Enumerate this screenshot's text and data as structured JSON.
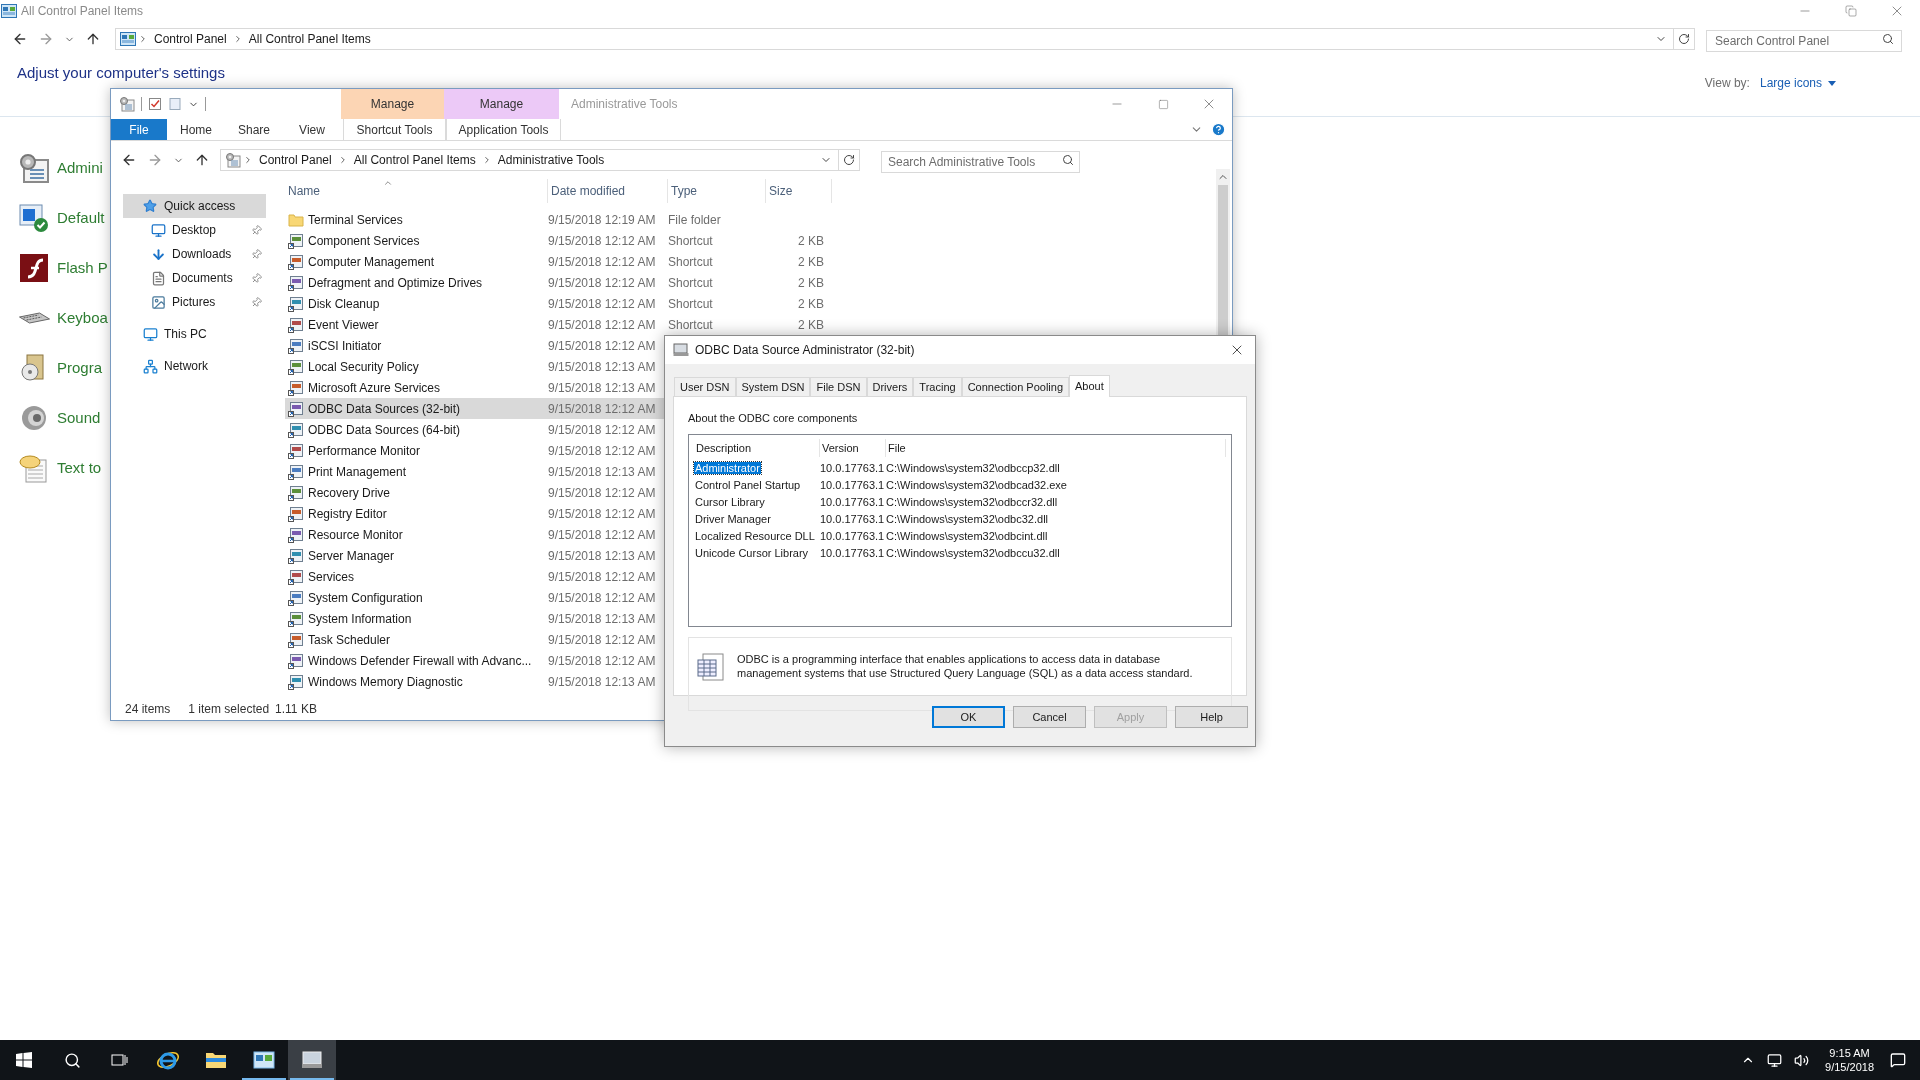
{
  "control_panel": {
    "title": "All Control Panel Items",
    "breadcrumb": [
      "Control Panel",
      "All Control Panel Items"
    ],
    "search": {
      "placeholder": "Search Control Panel"
    },
    "heading": "Adjust your computer's settings",
    "view_by": {
      "label": "View by:",
      "value": "Large icons"
    },
    "items": [
      {
        "label": "Admini"
      },
      {
        "label": "Default"
      },
      {
        "label": "Flash P"
      },
      {
        "label": "Keyboa"
      },
      {
        "label": "Progra"
      },
      {
        "label": "Sound"
      },
      {
        "label": "Text to"
      }
    ]
  },
  "explorer": {
    "title": "Administrative Tools",
    "context_tabs": [
      {
        "group": "Manage",
        "tab": "Shortcut Tools",
        "color": "#fcd5b4"
      },
      {
        "group": "Manage",
        "tab": "Application Tools",
        "color": "#ecc9f7"
      }
    ],
    "ribbon_tabs": [
      {
        "label": "File",
        "kind": "file"
      },
      {
        "label": "Home",
        "kind": "tab"
      },
      {
        "label": "Share",
        "kind": "tab"
      },
      {
        "label": "View",
        "kind": "tab"
      }
    ],
    "breadcrumb": [
      "Control Panel",
      "All Control Panel Items",
      "Administrative Tools"
    ],
    "search": {
      "placeholder": "Search Administrative Tools"
    },
    "nav": [
      {
        "label": "Quick access",
        "selected": true,
        "children": [
          {
            "label": "Desktop",
            "pinned": true,
            "selected": false
          },
          {
            "label": "Downloads",
            "pinned": true,
            "selected": false
          },
          {
            "label": "Documents",
            "pinned": true,
            "selected": false
          },
          {
            "label": "Pictures",
            "pinned": true,
            "selected": false
          }
        ]
      },
      {
        "label": "This PC",
        "selected": false
      },
      {
        "label": "Network",
        "selected": false
      }
    ],
    "columns": [
      "Name",
      "Date modified",
      "Type",
      "Size"
    ],
    "rows": [
      {
        "name": "Terminal Services",
        "date": "9/15/2018 12:19 AM",
        "type": "File folder",
        "kind": "folder",
        "selected": false
      },
      {
        "name": "Component Services",
        "date": "9/15/2018 12:12 AM",
        "type": "Shortcut",
        "size": "2 KB",
        "kind": "shortcut",
        "selected": false
      },
      {
        "name": "Computer Management",
        "date": "9/15/2018 12:12 AM",
        "type": "Shortcut",
        "size": "2 KB",
        "kind": "shortcut",
        "selected": false
      },
      {
        "name": "Defragment and Optimize Drives",
        "date": "9/15/2018 12:12 AM",
        "type": "Shortcut",
        "size": "2 KB",
        "kind": "shortcut",
        "selected": false
      },
      {
        "name": "Disk Cleanup",
        "date": "9/15/2018 12:12 AM",
        "type": "Shortcut",
        "size": "2 KB",
        "kind": "shortcut",
        "selected": false
      },
      {
        "name": "Event Viewer",
        "date": "9/15/2018 12:12 AM",
        "type": "Shortcut",
        "size": "2 KB",
        "kind": "shortcut",
        "selected": false
      },
      {
        "name": "iSCSI Initiator",
        "date": "9/15/2018 12:12 AM",
        "kind": "shortcut",
        "selected": false
      },
      {
        "name": "Local Security Policy",
        "date": "9/15/2018 12:13 AM",
        "kind": "shortcut",
        "selected": false
      },
      {
        "name": "Microsoft Azure Services",
        "date": "9/15/2018 12:13 AM",
        "kind": "shortcut",
        "selected": false
      },
      {
        "name": "ODBC Data Sources (32-bit)",
        "date": "9/15/2018 12:12 AM",
        "kind": "shortcut",
        "selected": true
      },
      {
        "name": "ODBC Data Sources (64-bit)",
        "date": "9/15/2018 12:12 AM",
        "kind": "shortcut",
        "selected": false
      },
      {
        "name": "Performance Monitor",
        "date": "9/15/2018 12:12 AM",
        "kind": "shortcut",
        "selected": false
      },
      {
        "name": "Print Management",
        "date": "9/15/2018 12:13 AM",
        "kind": "shortcut",
        "selected": false
      },
      {
        "name": "Recovery Drive",
        "date": "9/15/2018 12:12 AM",
        "kind": "shortcut",
        "selected": false
      },
      {
        "name": "Registry Editor",
        "date": "9/15/2018 12:12 AM",
        "kind": "shortcut",
        "selected": false
      },
      {
        "name": "Resource Monitor",
        "date": "9/15/2018 12:12 AM",
        "kind": "shortcut",
        "selected": false
      },
      {
        "name": "Server Manager",
        "date": "9/15/2018 12:13 AM",
        "kind": "shortcut",
        "selected": false
      },
      {
        "name": "Services",
        "date": "9/15/2018 12:12 AM",
        "kind": "shortcut",
        "selected": false
      },
      {
        "name": "System Configuration",
        "date": "9/15/2018 12:12 AM",
        "kind": "shortcut",
        "selected": false
      },
      {
        "name": "System Information",
        "date": "9/15/2018 12:13 AM",
        "kind": "shortcut",
        "selected": false
      },
      {
        "name": "Task Scheduler",
        "date": "9/15/2018 12:12 AM",
        "kind": "shortcut",
        "selected": false
      },
      {
        "name": "Windows Defender Firewall with Advanc...",
        "date": "9/15/2018 12:12 AM",
        "kind": "shortcut",
        "selected": false
      },
      {
        "name": "Windows Memory Diagnostic",
        "date": "9/15/2018 12:13 AM",
        "kind": "shortcut",
        "selected": false
      }
    ],
    "status": [
      "24 items",
      "1 item selected",
      "1.11 KB"
    ]
  },
  "dialog": {
    "title": "ODBC Data Source Administrator (32-bit)",
    "tabs": [
      {
        "label": "User DSN",
        "selected": false
      },
      {
        "label": "System DSN",
        "selected": false
      },
      {
        "label": "File DSN",
        "selected": false
      },
      {
        "label": "Drivers",
        "selected": false
      },
      {
        "label": "Tracing",
        "selected": false
      },
      {
        "label": "Connection Pooling",
        "selected": false
      },
      {
        "label": "About",
        "selected": true
      }
    ],
    "section_label": "About the ODBC core components",
    "columns": [
      "Description",
      "Version",
      "File"
    ],
    "rows": [
      {
        "description": "Administrator",
        "version": "10.0.17763.1",
        "file": "C:\\Windows\\system32\\odbccp32.dll",
        "selected": true
      },
      {
        "description": "Control Panel Startup",
        "version": "10.0.17763.1",
        "file": "C:\\Windows\\system32\\odbcad32.exe",
        "selected": false
      },
      {
        "description": "Cursor Library",
        "version": "10.0.17763.1",
        "file": "C:\\Windows\\system32\\odbccr32.dll",
        "selected": false
      },
      {
        "description": "Driver Manager",
        "version": "10.0.17763.1",
        "file": "C:\\Windows\\system32\\odbc32.dll",
        "selected": false
      },
      {
        "description": "Localized Resource DLL",
        "version": "10.0.17763.1",
        "file": "C:\\Windows\\system32\\odbcint.dll",
        "selected": false
      },
      {
        "description": "Unicode Cursor Library",
        "version": "10.0.17763.1",
        "file": "C:\\Windows\\system32\\odbccu32.dll",
        "selected": false
      }
    ],
    "info": "ODBC is a programming interface that enables applications to access data in database management systems that use Structured Query Language (SQL) as a data access standard.",
    "buttons": [
      {
        "label": "OK",
        "default": true,
        "disabled": false
      },
      {
        "label": "Cancel",
        "default": false,
        "disabled": false
      },
      {
        "label": "Apply",
        "default": false,
        "disabled": true
      },
      {
        "label": "Help",
        "default": false,
        "disabled": false
      }
    ]
  },
  "taskbar": {
    "apps": [
      {
        "running": false,
        "selected": false
      },
      {
        "running": false,
        "selected": false
      },
      {
        "running": true,
        "selected": false
      },
      {
        "running": true,
        "selected": true
      }
    ],
    "clock": {
      "time": "9:15 AM",
      "date": "9/15/2018"
    }
  }
}
